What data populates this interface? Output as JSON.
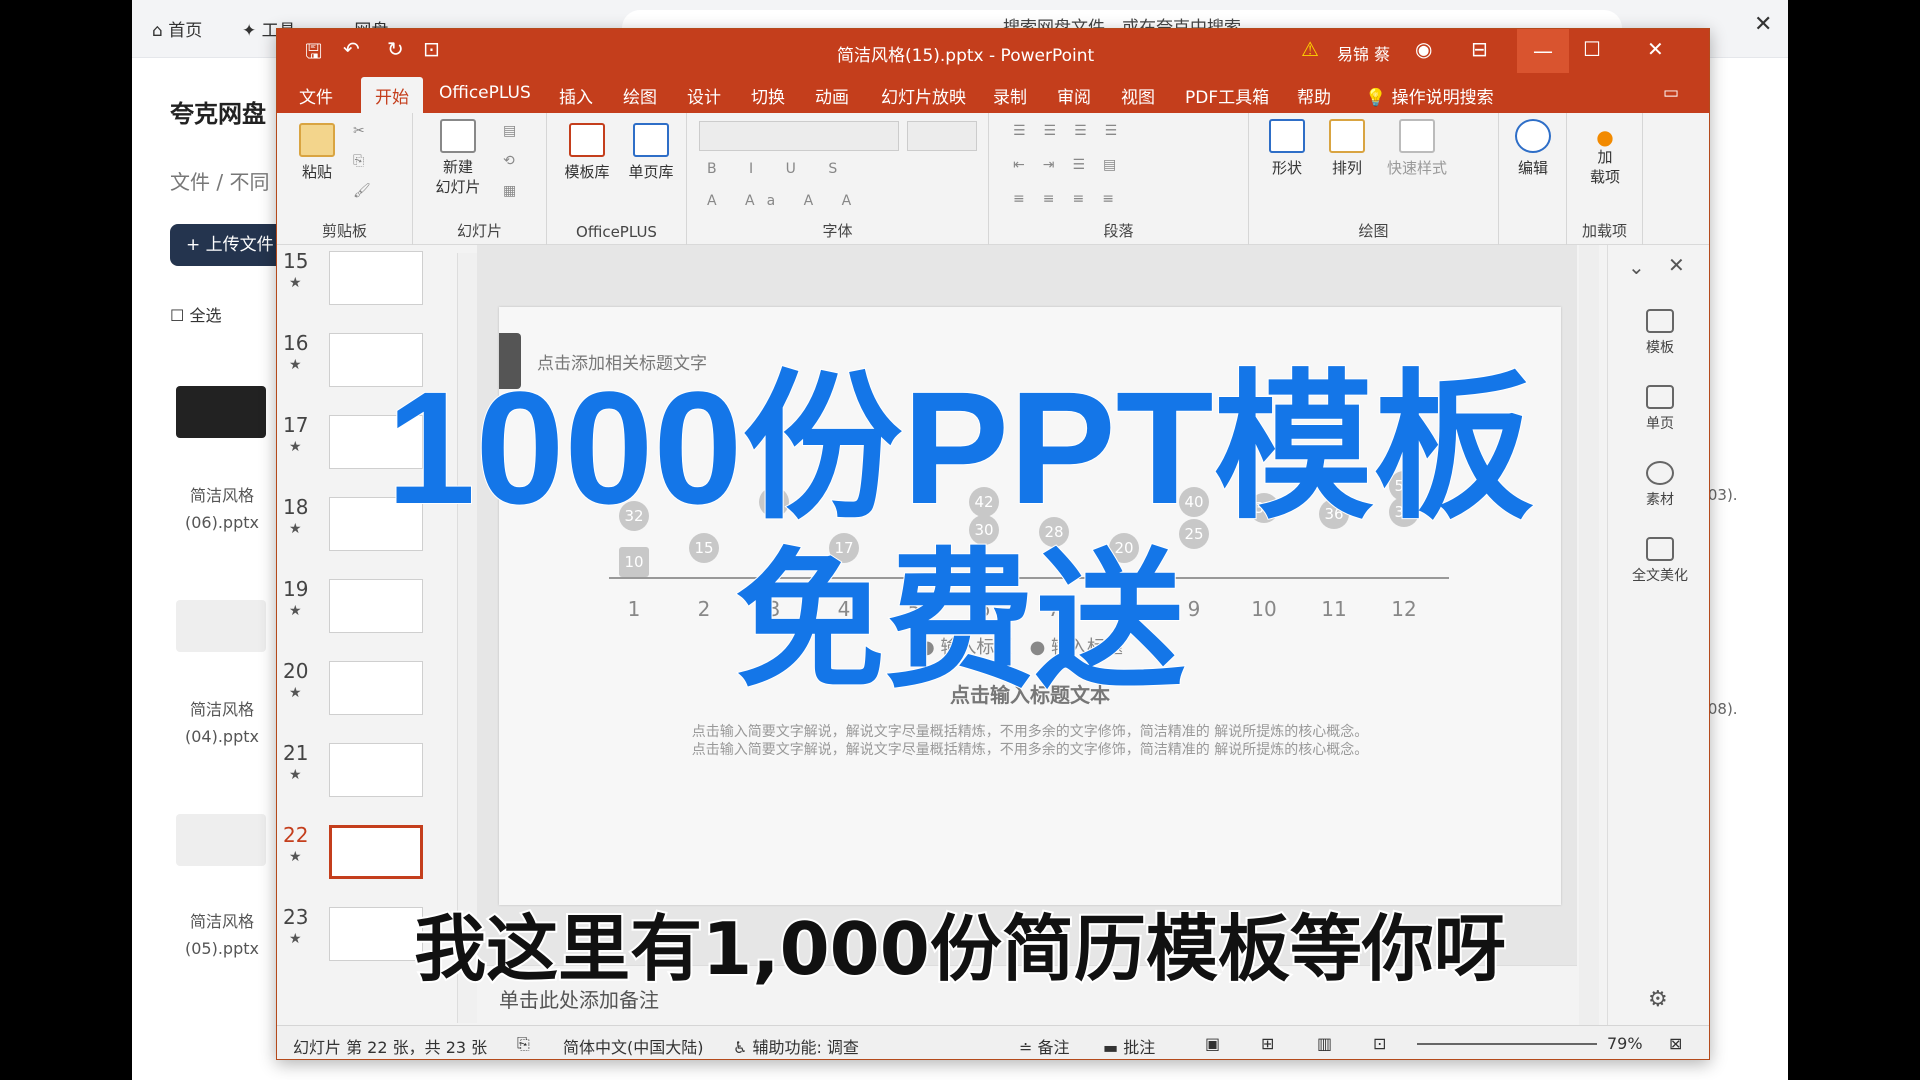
{
  "browser": {
    "tab_home": "首页",
    "tab_tools": "工具",
    "tab_netdisk": "网盘",
    "url_text": "搜索网盘文件，或在夸克中搜索",
    "app_title": "夸克网盘",
    "breadcrumb": "文件 / 不同",
    "upload_label": "+ 上传文件",
    "select_all": "全选",
    "files": [
      "简洁风格(06).pptx",
      "简洁风格(04).pptx",
      "简洁风格(05).pptx"
    ],
    "right_files": [
      "(03).",
      "(08)."
    ]
  },
  "ppt": {
    "title": "简洁风格(15).pptx - PowerPoint",
    "user": "易锦 蔡",
    "menus": [
      "文件",
      "开始",
      "OfficePLUS",
      "插入",
      "绘图",
      "设计",
      "切换",
      "动画",
      "幻灯片放映",
      "录制",
      "审阅",
      "视图",
      "PDF工具箱",
      "帮助",
      "操作说明搜索"
    ],
    "ribbon": {
      "paste": "粘贴",
      "clipboard": "剪贴板",
      "new_slide": "新建\n幻灯片",
      "slides": "幻灯片",
      "template_lib": "模板库",
      "single_lib": "单页库",
      "officeplus": "OfficePLUS",
      "font": "字体",
      "paragraph": "段落",
      "shape": "形状",
      "arrange": "排列",
      "quick_style": "快速样式",
      "drawing": "绘图",
      "edit": "编辑",
      "addin": "加\n载项",
      "addins": "加载项"
    },
    "thumbs": [
      {
        "num": "15"
      },
      {
        "num": "16"
      },
      {
        "num": "17"
      },
      {
        "num": "18"
      },
      {
        "num": "19"
      },
      {
        "num": "20"
      },
      {
        "num": "21"
      },
      {
        "num": "22"
      },
      {
        "num": "23"
      }
    ],
    "slide": {
      "title_placeholder": "点击添加相关标题文字",
      "x_labels": [
        "1",
        "2",
        "3",
        "4",
        "5",
        "6",
        "7",
        "8",
        "9",
        "10",
        "11",
        "12"
      ],
      "points_a": [
        "32",
        "15",
        "40",
        "17",
        "42",
        "30",
        "28",
        "20",
        "40",
        "38",
        "36",
        "50"
      ],
      "points_b": [
        "10",
        "25",
        "35"
      ],
      "legend": [
        "输入标题",
        "输入标题"
      ],
      "heading": "点击输入标题文本",
      "body1": "点击输入简要文字解说，解说文字尽量概括精炼，不用多余的文字修饰，简洁精准的 解说所提炼的核心概念。",
      "body2": "点击输入简要文字解说，解说文字尽量概括精炼，不用多余的文字修饰，简洁精准的 解说所提炼的核心概念。"
    },
    "notes_placeholder": "单击此处添加备注",
    "side_panel": [
      "模板",
      "单页",
      "素材",
      "全文美化"
    ],
    "status": {
      "slide_count": "幻灯片 第 22 张，共 23 张",
      "language": "简体中文(中国大陆)",
      "accessibility": "辅助功能: 调查",
      "notes": "备注",
      "comments": "批注",
      "zoom": "79%"
    }
  },
  "overlay": {
    "line1": "1000份PPT模板",
    "line2": "免费送",
    "subtitle": "我这里有1,000份简历模板等你呀"
  }
}
